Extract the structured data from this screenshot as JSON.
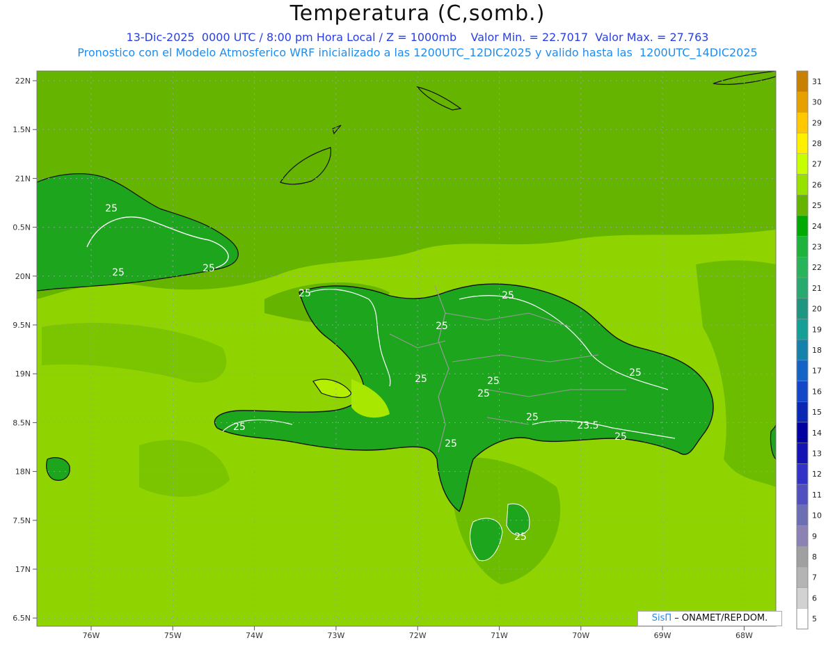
{
  "header": {
    "title": "Temperatura (C,somb.)",
    "line1": "13-Dic-2025  0000 UTC / 8:00 pm Hora Local / Z = 1000mb    Valor Min. = 22.7017  Valor Max. = 27.763",
    "line2": "Pronostico con el Modelo Atmosferico WRF inicializado a las 1200UTC_12DIC2025 y valido hasta las  1200UTC_14DIC2025"
  },
  "axes": {
    "lat_labels": [
      "22N",
      "1.5N",
      "21N",
      "0.5N",
      "20N",
      "9.5N",
      "19N",
      "8.5N",
      "18N",
      "7.5N",
      "17N",
      "6.5N"
    ],
    "lon_labels": [
      "76W",
      "75W",
      "74W",
      "73W",
      "72W",
      "71W",
      "70W",
      "69W",
      "68W"
    ]
  },
  "colorbar": {
    "labels": [
      "31",
      "30",
      "29",
      "28",
      "27",
      "26",
      "25",
      "24",
      "23",
      "22",
      "21",
      "20",
      "19",
      "18",
      "17",
      "16",
      "15",
      "14",
      "13",
      "12",
      "11",
      "10",
      "9",
      "8",
      "7",
      "6",
      "5"
    ],
    "colors": [
      "#c88000",
      "#e6a000",
      "#ffc800",
      "#fff000",
      "#c8ff00",
      "#96e100",
      "#64b400",
      "#00aa00",
      "#1eb43c",
      "#28b45a",
      "#28aa6e",
      "#1e9682",
      "#14a096",
      "#1482aa",
      "#1464c8",
      "#1446c8",
      "#0a28b4",
      "#0000a0",
      "#1414b4",
      "#3232c8",
      "#5050c0",
      "#6e6eb4",
      "#8c82b4",
      "#a0a0a0",
      "#b4b4b4",
      "#d2d2d2",
      "#ffffff"
    ]
  },
  "contour_labels": [
    "25",
    "25",
    "25",
    "25",
    "25",
    "25",
    "25",
    "25",
    "25",
    "25",
    "25",
    "23.5",
    "25",
    "25",
    "25",
    "25"
  ],
  "credit": {
    "logo": "SisΠ",
    "text": "– ONAMET/REP.DOM."
  }
}
